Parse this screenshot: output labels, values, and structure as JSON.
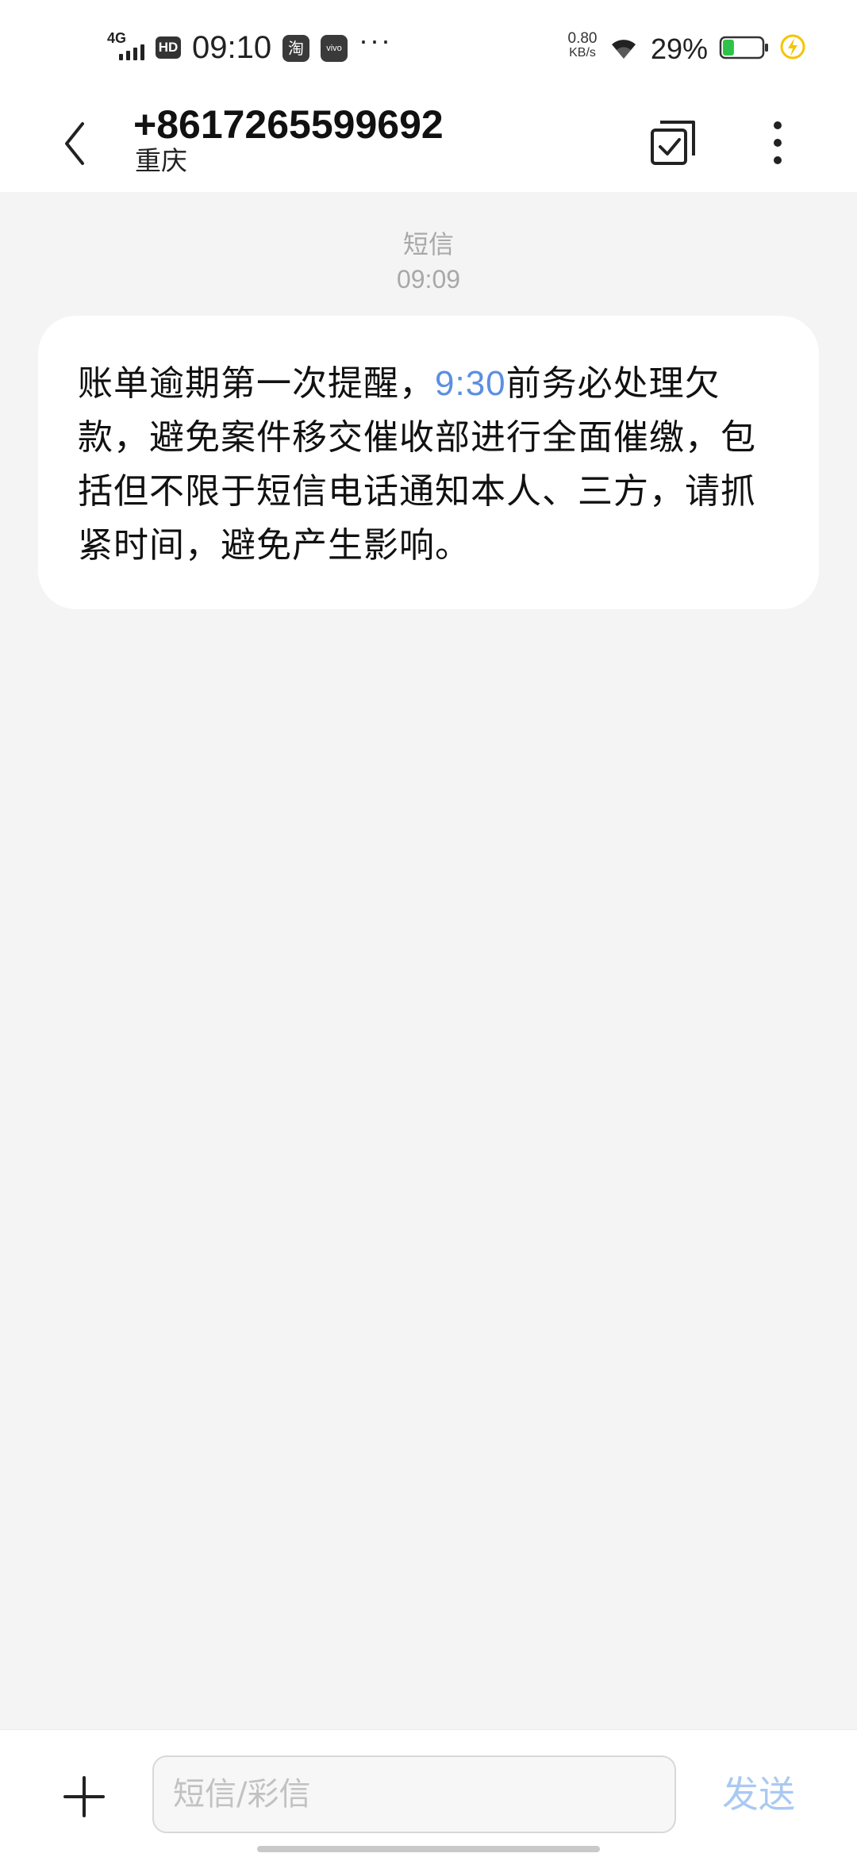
{
  "status_bar": {
    "network": "4G",
    "hd_badge": "HD",
    "time": "09:10",
    "app_icons": [
      "淘",
      "vivo"
    ],
    "more": "···",
    "speed_value": "0.80",
    "speed_unit": "KB/s",
    "battery_percent": "29%",
    "battery_level": 0.29,
    "charging": true,
    "colors": {
      "battery_fill": "#2fc24a",
      "charge_bolt": "#f5c400"
    }
  },
  "header": {
    "contact": "+8617265599692",
    "location": "重庆"
  },
  "conversation": {
    "type_label": "短信",
    "time": "09:09",
    "message": {
      "text_before": "账单逾期第一次提醒，",
      "link_text": "9:30",
      "text_after": "前务必处理欠款，避免案件移交催收部进行全面催缴，包括但不限于短信电话通知本人、三方，请抓紧时间，避免产生影响。"
    }
  },
  "composer": {
    "placeholder": "短信/彩信",
    "send_label": "发送",
    "colors": {
      "send": "#a9c9f1",
      "link": "#5b8fe0"
    }
  }
}
